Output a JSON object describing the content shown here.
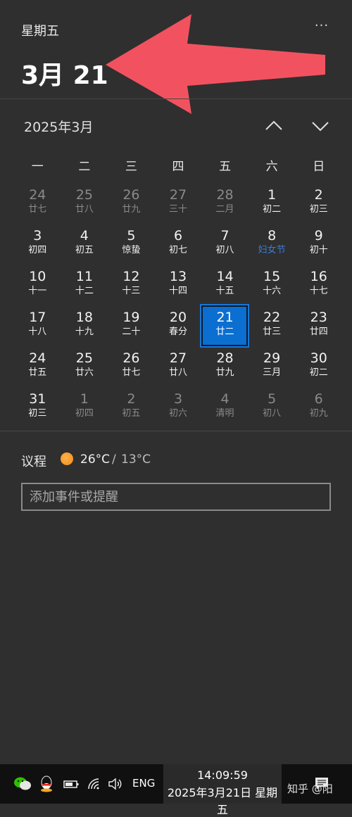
{
  "header": {
    "day_of_week": "星期五",
    "big_date": "3月 21",
    "more_icon": "more-dots-icon"
  },
  "calendar": {
    "month_title": "2025年3月",
    "nav_up_icon": "chevron-up-icon",
    "nav_down_icon": "chevron-down-icon",
    "weekdays": [
      "一",
      "二",
      "三",
      "四",
      "五",
      "六",
      "日"
    ],
    "days": [
      {
        "day": "24",
        "lunar": "廿七",
        "month": "other"
      },
      {
        "day": "25",
        "lunar": "廿八",
        "month": "other"
      },
      {
        "day": "26",
        "lunar": "廿九",
        "month": "other"
      },
      {
        "day": "27",
        "lunar": "三十",
        "month": "other"
      },
      {
        "day": "28",
        "lunar": "二月",
        "month": "other"
      },
      {
        "day": "1",
        "lunar": "初二",
        "month": "current"
      },
      {
        "day": "2",
        "lunar": "初三",
        "month": "current"
      },
      {
        "day": "3",
        "lunar": "初四",
        "month": "current"
      },
      {
        "day": "4",
        "lunar": "初五",
        "month": "current"
      },
      {
        "day": "5",
        "lunar": "惊蛰",
        "month": "current"
      },
      {
        "day": "6",
        "lunar": "初七",
        "month": "current"
      },
      {
        "day": "7",
        "lunar": "初八",
        "month": "current"
      },
      {
        "day": "8",
        "lunar": "妇女节",
        "month": "current",
        "festival": true
      },
      {
        "day": "9",
        "lunar": "初十",
        "month": "current"
      },
      {
        "day": "10",
        "lunar": "十一",
        "month": "current"
      },
      {
        "day": "11",
        "lunar": "十二",
        "month": "current"
      },
      {
        "day": "12",
        "lunar": "十三",
        "month": "current"
      },
      {
        "day": "13",
        "lunar": "十四",
        "month": "current"
      },
      {
        "day": "14",
        "lunar": "十五",
        "month": "current"
      },
      {
        "day": "15",
        "lunar": "十六",
        "month": "current"
      },
      {
        "day": "16",
        "lunar": "十七",
        "month": "current"
      },
      {
        "day": "17",
        "lunar": "十八",
        "month": "current"
      },
      {
        "day": "18",
        "lunar": "十九",
        "month": "current"
      },
      {
        "day": "19",
        "lunar": "二十",
        "month": "current"
      },
      {
        "day": "20",
        "lunar": "春分",
        "month": "current"
      },
      {
        "day": "21",
        "lunar": "廿二",
        "month": "current",
        "today": true
      },
      {
        "day": "22",
        "lunar": "廿三",
        "month": "current"
      },
      {
        "day": "23",
        "lunar": "廿四",
        "month": "current"
      },
      {
        "day": "24",
        "lunar": "廿五",
        "month": "current"
      },
      {
        "day": "25",
        "lunar": "廿六",
        "month": "current"
      },
      {
        "day": "26",
        "lunar": "廿七",
        "month": "current"
      },
      {
        "day": "27",
        "lunar": "廿八",
        "month": "current"
      },
      {
        "day": "28",
        "lunar": "廿九",
        "month": "current"
      },
      {
        "day": "29",
        "lunar": "三月",
        "month": "current"
      },
      {
        "day": "30",
        "lunar": "初二",
        "month": "current"
      },
      {
        "day": "31",
        "lunar": "初三",
        "month": "current"
      },
      {
        "day": "1",
        "lunar": "初四",
        "month": "other"
      },
      {
        "day": "2",
        "lunar": "初五",
        "month": "other"
      },
      {
        "day": "3",
        "lunar": "初六",
        "month": "other"
      },
      {
        "day": "4",
        "lunar": "清明",
        "month": "other"
      },
      {
        "day": "5",
        "lunar": "初八",
        "month": "other"
      },
      {
        "day": "6",
        "lunar": "初九",
        "month": "other"
      }
    ]
  },
  "agenda": {
    "title": "议程",
    "weather_icon": "sun-icon",
    "temp_high": "26°C",
    "temp_separator": "/",
    "temp_low": "13°C",
    "input_placeholder": "添加事件或提醒"
  },
  "taskbar": {
    "icons": [
      "wechat-icon",
      "qq-icon",
      "battery-plug-icon",
      "wifi-icon",
      "volume-icon"
    ],
    "language": "ENG",
    "time": "14:09:59",
    "date": "2025年3月21日 星期五",
    "watermark": "知乎 @阳",
    "notification_icon": "notification-icon"
  },
  "colors": {
    "background": "#2f2f2f",
    "accent": "#0b6fd1",
    "arrow": "#f2525f",
    "festival_text": "#3a7bd5"
  }
}
